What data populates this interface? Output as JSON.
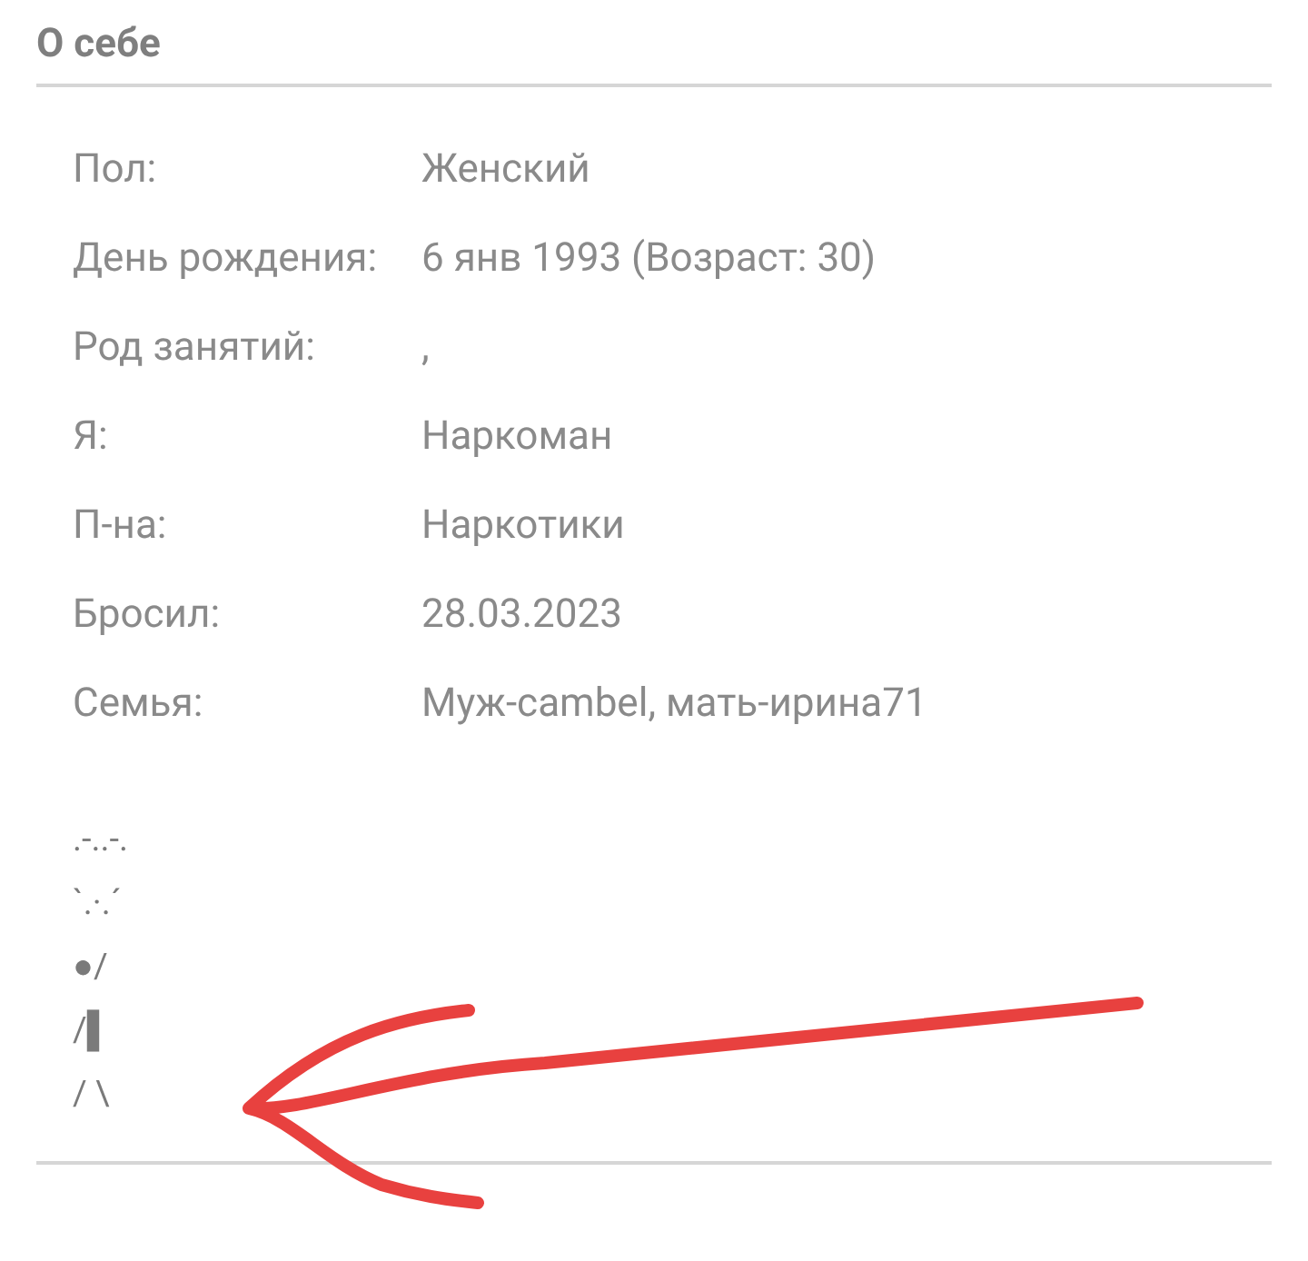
{
  "section": {
    "title": "О себе"
  },
  "fields": [
    {
      "label": "Пол:",
      "value": "Женский"
    },
    {
      "label": "День рождения:",
      "value": "6 янв 1993 (Возраст: 30)"
    },
    {
      "label": "Род занятий:",
      "value": ","
    },
    {
      "label": "Я:",
      "value": "Наркоман"
    },
    {
      "label": "П-на:",
      "value": "Наркотики"
    },
    {
      "label": "Бросил:",
      "value": "28.03.2023"
    },
    {
      "label": "Семья:",
      "value": "Муж-cambel, мать-ирина71"
    }
  ],
  "ascii_art": [
    ".-..-.",
    "`.·.´",
    "●/",
    "/▌",
    "/ \\"
  ]
}
